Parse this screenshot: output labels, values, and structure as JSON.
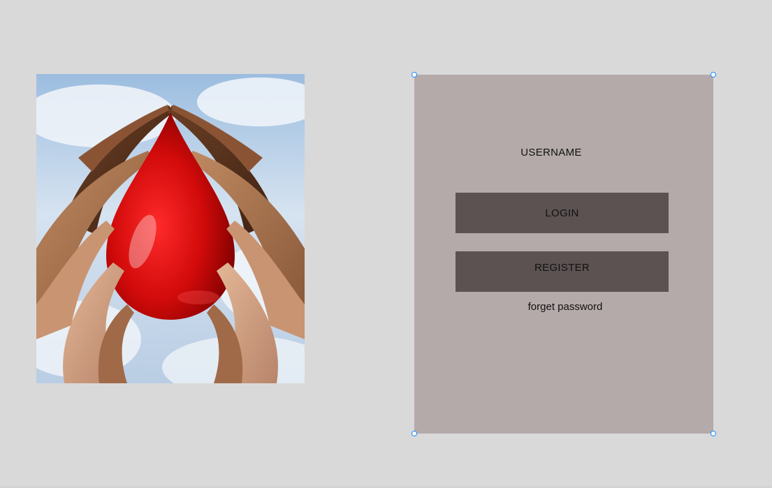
{
  "hero": {
    "icon": "blood-drop-hands-image"
  },
  "login_panel": {
    "username_label": "USERNAME",
    "login_button": "LOGIN",
    "register_button": "REGISTER",
    "forget_password_link": "forget password"
  },
  "colors": {
    "canvas": "#d9d9d9",
    "panel": "#b5aaaa",
    "button": "#5c5252",
    "selection_handle": "#1a8cff",
    "drop_red": "#d10a0a"
  }
}
